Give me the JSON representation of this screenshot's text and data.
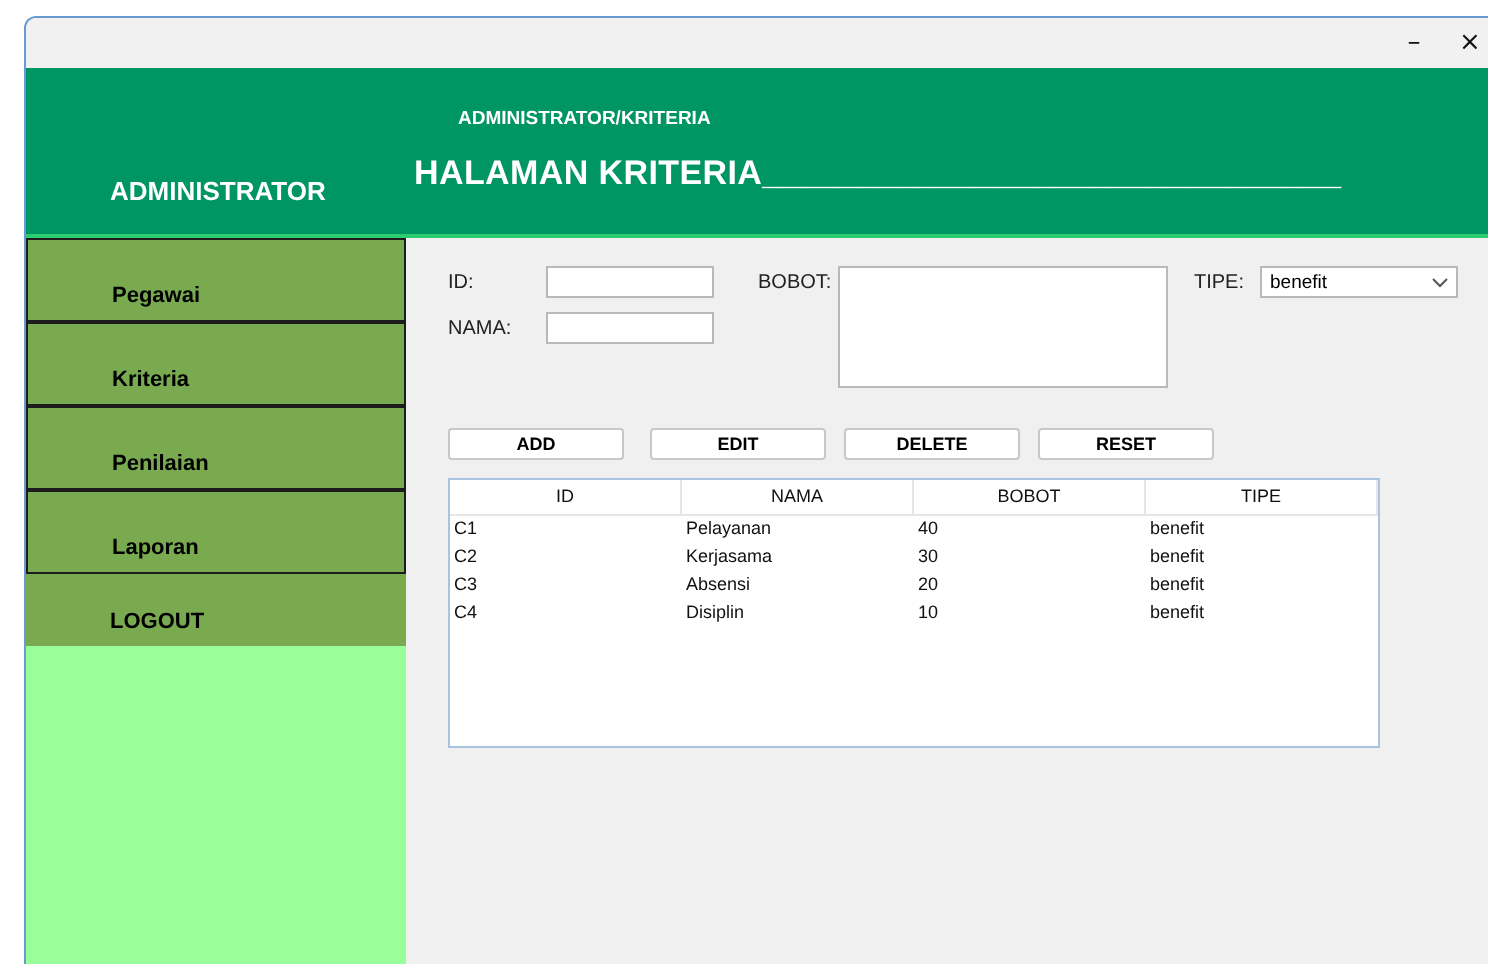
{
  "window": {
    "controls": [
      "–",
      "×"
    ]
  },
  "header": {
    "breadcrumb": "ADMINISTRATOR/KRITERIA",
    "role": "ADMINISTRATOR",
    "title": "HALAMAN KRITERIA______________________________"
  },
  "sidebar": {
    "items": [
      {
        "label": "Pegawai"
      },
      {
        "label": "Kriteria"
      },
      {
        "label": "Penilaian"
      },
      {
        "label": "Laporan"
      }
    ],
    "logout": "LOGOUT"
  },
  "form": {
    "id_label": "ID:",
    "nama_label": "NAMA:",
    "bobot_label": "BOBOT:",
    "tipe_label": "TIPE:",
    "tipe_value": "benefit"
  },
  "buttons": [
    "ADD",
    "EDIT",
    "DELETE",
    "RESET"
  ],
  "table": {
    "columns": [
      "ID",
      "NAMA",
      "BOBOT",
      "TIPE"
    ],
    "rows": [
      [
        "C1",
        "Pelayanan",
        "40",
        "benefit"
      ],
      [
        "C2",
        "Kerjasama",
        "30",
        "benefit"
      ],
      [
        "C3",
        "Absensi",
        "20",
        "benefit"
      ],
      [
        "C4",
        "Disiplin",
        "10",
        "benefit"
      ]
    ]
  }
}
